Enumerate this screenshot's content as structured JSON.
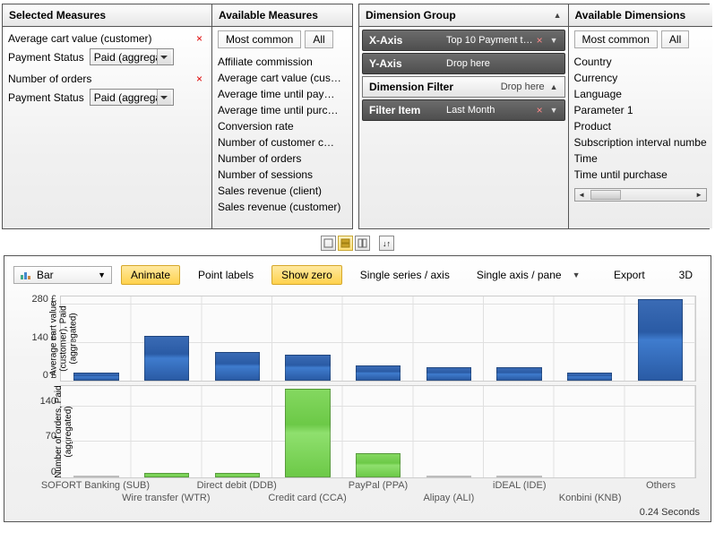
{
  "panels": {
    "selected_measures_title": "Selected Measures",
    "available_measures_title": "Available Measures",
    "dimension_group_title": "Dimension Group",
    "available_dimensions_title": "Available Dimensions"
  },
  "selected_measures": [
    {
      "name": "Average cart value (customer)",
      "sub_label": "Payment Status",
      "sub_value": "Paid (aggrega"
    },
    {
      "name": "Number of orders",
      "sub_label": "Payment Status",
      "sub_value": "Paid (aggrega"
    }
  ],
  "avail_measures": {
    "tab_common": "Most common",
    "tab_all": "All",
    "items": [
      "Affiliate commission",
      "Average cart value (cus…",
      "Average time until pay…",
      "Average time until purc…",
      "Conversion rate",
      "Number of customer c…",
      "Number of orders",
      "Number of sessions",
      "Sales revenue (client)",
      "Sales revenue (customer)"
    ]
  },
  "dimension_group": {
    "xaxis_label": "X-Axis",
    "xaxis_value": "Top 10 Payment t…",
    "yaxis_label": "Y-Axis",
    "yaxis_value": "Drop here",
    "filter_header": "Dimension Filter",
    "filter_header_value": "Drop here",
    "filter_item_label": "Filter Item",
    "filter_item_value": "Last Month"
  },
  "avail_dimensions": {
    "tab_common": "Most common",
    "tab_all": "All",
    "items": [
      "Country",
      "Currency",
      "Language",
      "Parameter 1",
      "Product",
      "Subscription interval numbe",
      "Time",
      "Time until purchase"
    ]
  },
  "toolbar": {
    "chart_type": "Bar",
    "animate": "Animate",
    "point_labels": "Point labels",
    "show_zero": "Show zero",
    "single_series": "Single series / axis",
    "single_axis": "Single axis / pane",
    "export": "Export",
    "threeD": "3D"
  },
  "chart_data": [
    {
      "type": "bar",
      "title": "",
      "ylabel": "Average cart value (customer), Paid (aggregated)",
      "yunit": "£",
      "ylim": [
        0,
        310
      ],
      "yticks": [
        0,
        140,
        280
      ],
      "categories": [
        "SOFORT Banking (SUB)",
        "Wire transfer (WTR)",
        "Direct debit (DDB)",
        "Credit card (CCA)",
        "PayPal (PPA)",
        "Alipay (ALI)",
        "iDEAL (IDE)",
        "Konbini (KNB)",
        "Others"
      ],
      "values": [
        30,
        165,
        105,
        95,
        55,
        50,
        50,
        30,
        300
      ]
    },
    {
      "type": "bar",
      "title": "",
      "ylabel": "Number of orders, Paid (aggregated)",
      "ylim": [
        0,
        180
      ],
      "yticks": [
        0,
        70,
        140
      ],
      "categories": [
        "SOFORT Banking (SUB)",
        "Wire transfer (WTR)",
        "Direct debit (DDB)",
        "Credit card (CCA)",
        "PayPal (PPA)",
        "Alipay (ALI)",
        "iDEAL (IDE)",
        "Konbini (KNB)",
        "Others"
      ],
      "values": [
        1,
        8,
        8,
        175,
        48,
        1,
        4,
        0,
        0
      ]
    }
  ],
  "footer": {
    "seconds": "0.24 Seconds"
  },
  "yticks_display": {
    "p1": [
      "0 £",
      "140 £",
      "280 £"
    ],
    "p2": [
      "0",
      "70",
      "140"
    ]
  }
}
